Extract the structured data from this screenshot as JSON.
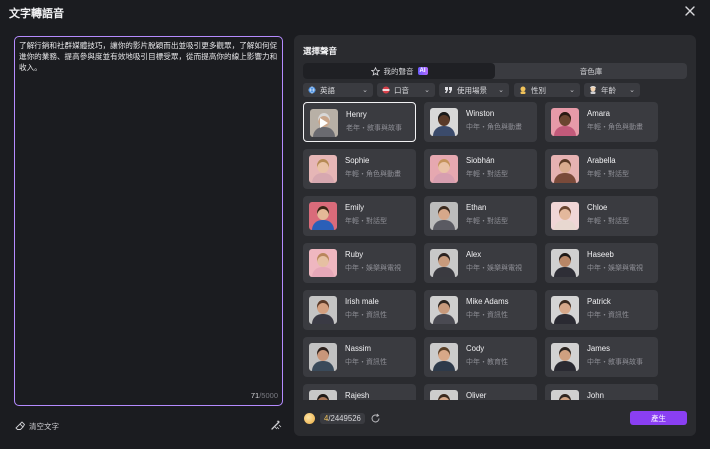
{
  "window": {
    "title": "文字轉語音"
  },
  "editor": {
    "text": "了解行銷和社群媒體技巧，讓你的影片脫穎而出並吸引更多觀眾，了解如何促進你的業務、提高參與度並有效地吸引目標受眾，從而提高你的線上影響力和收入。",
    "char_count": "71",
    "char_limit": "/5000"
  },
  "bottom_left": {
    "clear_label": "清空文字"
  },
  "panel": {
    "title": "選擇聲音",
    "tabs": {
      "my_voice": "我的聲音",
      "ai_badge": "AI",
      "voice_library": "音色庫"
    },
    "filters": [
      {
        "label": "英語",
        "icon": "globe-icon"
      },
      {
        "label": "口音",
        "icon": "accent-icon"
      },
      {
        "label": "使用場景",
        "icon": "quote-icon"
      },
      {
        "label": "性別",
        "icon": "gender-icon"
      },
      {
        "label": "年齡",
        "icon": "age-icon"
      }
    ],
    "voices": [
      {
        "name": "Henry",
        "desc": "老年・敘事與故事",
        "selected": true,
        "skin": "#c9a58a",
        "hair": "#d7d7d7",
        "shirt": "#6a6a70",
        "bg": "#b8b0a6"
      },
      {
        "name": "Winston",
        "desc": "中年・角色與動畫",
        "skin": "#5a3a28",
        "hair": "#1a1a1a",
        "shirt": "#3b4b6b",
        "bg": "#d8d8d8"
      },
      {
        "name": "Amara",
        "desc": "年輕・角色與動畫",
        "skin": "#6b4530",
        "hair": "#2a1a12",
        "shirt": "#c25a7a",
        "bg": "#e79aa8"
      },
      {
        "name": "Sophie",
        "desc": "年輕・角色與動畫",
        "skin": "#e9c2a6",
        "hair": "#b58a55",
        "shirt": "#d7a8b0",
        "bg": "#e6b6b6"
      },
      {
        "name": "Siobhán",
        "desc": "年輕・對話型",
        "skin": "#e9c2a6",
        "hair": "#c4935c",
        "shirt": "#d79fb0",
        "bg": "#e6a8b0"
      },
      {
        "name": "Arabella",
        "desc": "年輕・對話型",
        "skin": "#d9ab8e",
        "hair": "#5a3a26",
        "shirt": "#7a4a3a",
        "bg": "#e6b2b2"
      },
      {
        "name": "Emily",
        "desc": "年輕・對話型",
        "skin": "#e4b897",
        "hair": "#3a2416",
        "shirt": "#2a5fb8",
        "bg": "#d96b7a"
      },
      {
        "name": "Ethan",
        "desc": "年輕・對話型",
        "skin": "#d6a88a",
        "hair": "#3a2a1e",
        "shirt": "#5a5a62",
        "bg": "#bcbcbc"
      },
      {
        "name": "Chloe",
        "desc": "年輕・對話型",
        "skin": "#e3b89c",
        "hair": "#6a4530",
        "shirt": "#e8d8d0",
        "bg": "#f0d6d6"
      },
      {
        "name": "Ruby",
        "desc": "中年・娛樂與電視",
        "skin": "#e6c0a2",
        "hair": "#b9865c",
        "shirt": "#e6a8b8",
        "bg": "#efb7c0"
      },
      {
        "name": "Alex",
        "desc": "中年・娛樂與電視",
        "skin": "#c89a7c",
        "hair": "#2a2220",
        "shirt": "#3a3a40",
        "bg": "#c8c8c8"
      },
      {
        "name": "Haseeb",
        "desc": "中年・娛樂與電視",
        "skin": "#b88666",
        "hair": "#1e1a18",
        "shirt": "#2e2e36",
        "bg": "#d0d0d0"
      },
      {
        "name": "Irish male",
        "desc": "中年・資訊性",
        "skin": "#d4a080",
        "hair": "#5a3a28",
        "shirt": "#3a3a44",
        "bg": "#c4c4c4"
      },
      {
        "name": "Mike Adams",
        "desc": "中年・資訊性",
        "skin": "#c89a7c",
        "hair": "#2a2420",
        "shirt": "#4a4a52",
        "bg": "#cfcfcf"
      },
      {
        "name": "Patrick",
        "desc": "中年・資訊性",
        "skin": "#d6a88a",
        "hair": "#3a2a20",
        "shirt": "#2a2a32",
        "bg": "#d4d4d4"
      },
      {
        "name": "Nassim",
        "desc": "中年・資訊性",
        "skin": "#c8967a",
        "hair": "#2a201c",
        "shirt": "#3a4a5a",
        "bg": "#c2c2c2"
      },
      {
        "name": "Cody",
        "desc": "中年・教育性",
        "skin": "#d8a888",
        "hair": "#5a4028",
        "shirt": "#2e3a4a",
        "bg": "#cbcbcb"
      },
      {
        "name": "James",
        "desc": "中年・敘事與故事",
        "skin": "#d0a080",
        "hair": "#2a2420",
        "shirt": "#2a2a32",
        "bg": "#d2d2d2"
      },
      {
        "name": "Rajesh",
        "desc": "",
        "skin": "#a87556",
        "hair": "#1e1a18",
        "shirt": "#4a4a54",
        "bg": "#c8c8c8"
      },
      {
        "name": "Oliver",
        "desc": "",
        "skin": "#d6a88a",
        "hair": "#3a2a20",
        "shirt": "#3a3a44",
        "bg": "#cdcdcd"
      },
      {
        "name": "John",
        "desc": "",
        "skin": "#d0a282",
        "hair": "#2e2622",
        "shirt": "#2a2a32",
        "bg": "#d0d0d0"
      }
    ],
    "footer": {
      "credits_used": "4",
      "credits_total": "/2449526",
      "generate_label": "產生"
    }
  },
  "colors": {
    "accent": "#8a3ff2",
    "editor_border": "#b58bff",
    "panel_bg": "#2a2b2f",
    "card_bg": "#3a3b40"
  }
}
